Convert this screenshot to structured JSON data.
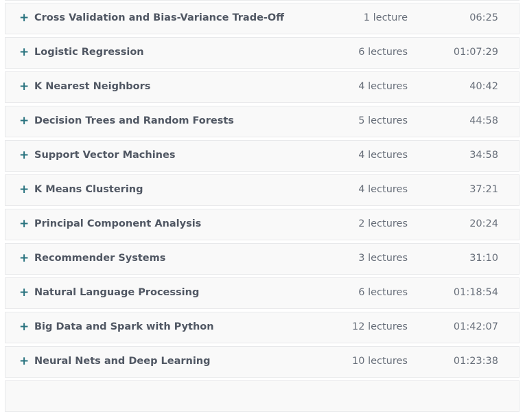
{
  "accent_color": "#29737f",
  "expand_icon": "plus-icon",
  "sections": [
    {
      "title": "Cross Validation and Bias-Variance Trade-Off",
      "lectures": "1 lecture",
      "duration": "06:25"
    },
    {
      "title": "Logistic Regression",
      "lectures": "6 lectures",
      "duration": "01:07:29"
    },
    {
      "title": "K Nearest Neighbors",
      "lectures": "4 lectures",
      "duration": "40:42"
    },
    {
      "title": "Decision Trees and Random Forests",
      "lectures": "5 lectures",
      "duration": "44:58"
    },
    {
      "title": "Support Vector Machines",
      "lectures": "4 lectures",
      "duration": "34:58"
    },
    {
      "title": "K Means Clustering",
      "lectures": "4 lectures",
      "duration": "37:21"
    },
    {
      "title": "Principal Component Analysis",
      "lectures": "2 lectures",
      "duration": "20:24"
    },
    {
      "title": "Recommender Systems",
      "lectures": "3 lectures",
      "duration": "31:10"
    },
    {
      "title": "Natural Language Processing",
      "lectures": "6 lectures",
      "duration": "01:18:54"
    },
    {
      "title": "Big Data and Spark with Python",
      "lectures": "12 lectures",
      "duration": "01:42:07"
    },
    {
      "title": "Neural Nets and Deep Learning",
      "lectures": "10 lectures",
      "duration": "01:23:38"
    }
  ]
}
